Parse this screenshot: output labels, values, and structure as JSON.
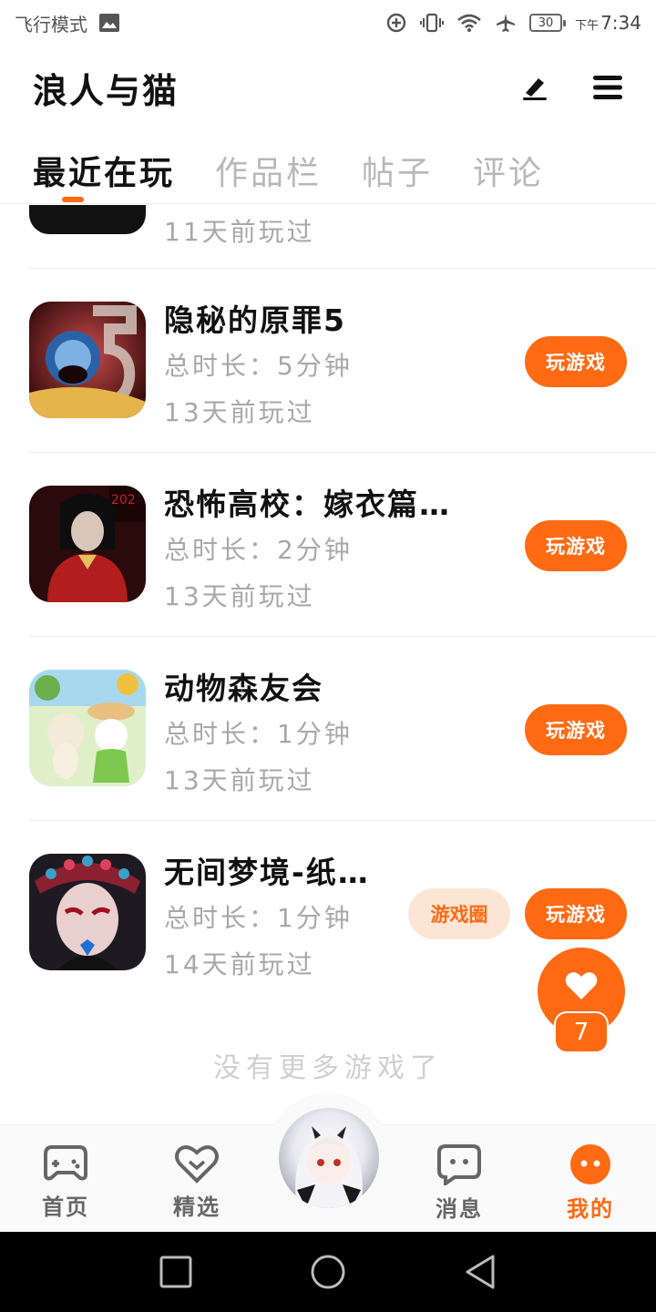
{
  "status_bar": {
    "mode_text": "飞行模式",
    "battery": "30",
    "time_prefix": "下午",
    "time": "7:34"
  },
  "header": {
    "title": "浪人与猫",
    "edit_icon": "pen-icon",
    "menu_icon": "hamburger-icon"
  },
  "tabs": [
    {
      "label": "最近在玩",
      "active": true
    },
    {
      "label": "作品栏",
      "active": false
    },
    {
      "label": "帖子",
      "active": false
    },
    {
      "label": "评论",
      "active": false
    }
  ],
  "partial_item": {
    "last_played": "11天前玩过"
  },
  "games": [
    {
      "title": "隐秘的原罪5",
      "duration": "总时长：5分钟",
      "last_played": "13天前玩过",
      "play_label": "玩游戏"
    },
    {
      "title": "恐怖高校：嫁衣篇…",
      "duration": "总时长：2分钟",
      "last_played": "13天前玩过",
      "play_label": "玩游戏",
      "thumb_label": "202"
    },
    {
      "title": "动物森友会",
      "duration": "总时长：1分钟",
      "last_played": "13天前玩过",
      "play_label": "玩游戏"
    },
    {
      "title": "无间梦境-纸…",
      "duration": "总时长：1分钟",
      "last_played": "14天前玩过",
      "play_label": "玩游戏",
      "circle_label": "游戏圈"
    }
  ],
  "end_text": "没有更多游戏了",
  "like": {
    "count": "7"
  },
  "bottom_nav": [
    {
      "label": "首页",
      "icon": "gamepad-icon"
    },
    {
      "label": "精选",
      "icon": "heart-badge-icon"
    },
    {
      "label": "消息",
      "icon": "chat-icon"
    },
    {
      "label": "我的",
      "icon": "face-icon",
      "active": true
    }
  ],
  "colors": {
    "accent": "#ff6a13",
    "accent_light": "#fde5d6",
    "muted_text": "#a8a8a8"
  }
}
